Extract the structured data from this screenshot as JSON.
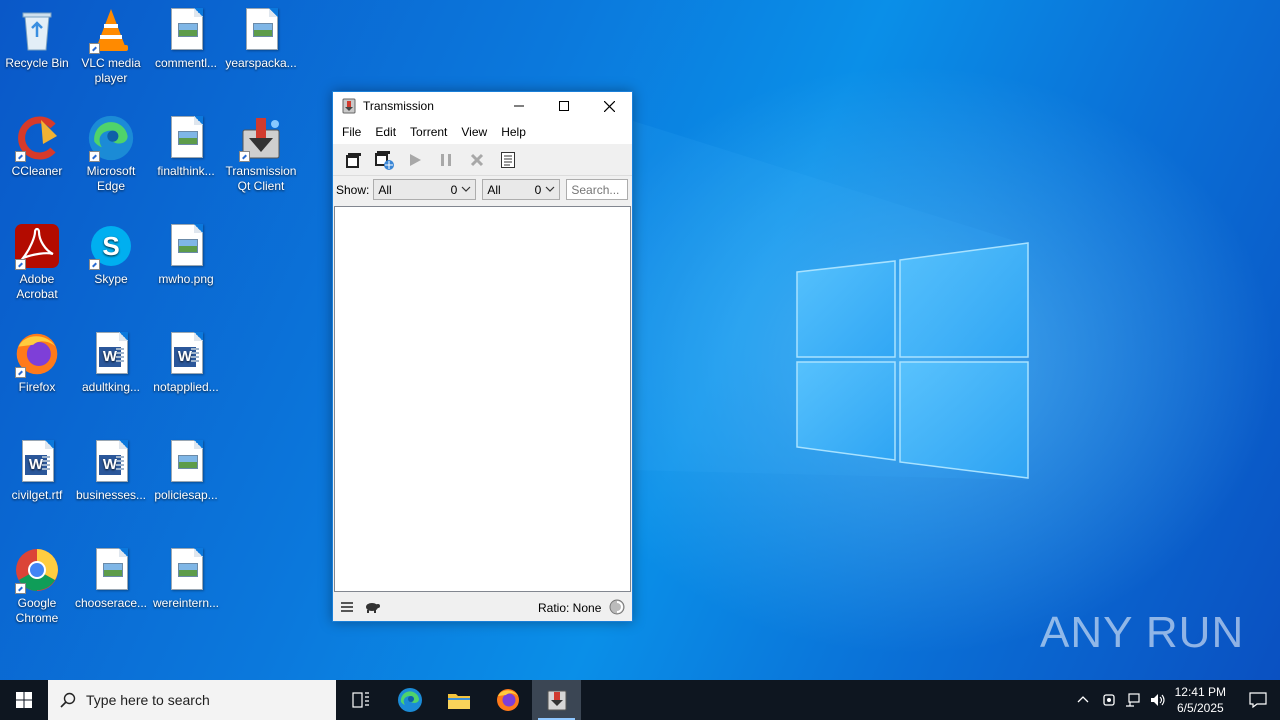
{
  "desktop": {
    "icons": [
      {
        "label": "Recycle Bin",
        "icon": "recycle-bin-icon"
      },
      {
        "label": "VLC media player",
        "icon": "vlc-icon"
      },
      {
        "label": "commentl...",
        "icon": "image-file-icon"
      },
      {
        "label": "yearspacka...",
        "icon": "image-file-icon"
      },
      {
        "label": "CCleaner",
        "icon": "ccleaner-icon"
      },
      {
        "label": "Microsoft Edge",
        "icon": "edge-icon"
      },
      {
        "label": "finalthink...",
        "icon": "image-file-icon"
      },
      {
        "label": "Transmission Qt Client",
        "icon": "transmission-icon"
      },
      {
        "label": "Adobe Acrobat",
        "icon": "acrobat-icon"
      },
      {
        "label": "Skype",
        "icon": "skype-icon"
      },
      {
        "label": "mwho.png",
        "icon": "image-file-icon"
      },
      {
        "label": "Firefox",
        "icon": "firefox-icon"
      },
      {
        "label": "adultking...",
        "icon": "word-file-icon"
      },
      {
        "label": "notapplied...",
        "icon": "word-file-icon"
      },
      {
        "label": "civilget.rtf",
        "icon": "word-file-icon"
      },
      {
        "label": "businesses...",
        "icon": "word-file-icon"
      },
      {
        "label": "policiesap...",
        "icon": "image-file-icon"
      },
      {
        "label": "Google Chrome",
        "icon": "chrome-icon"
      },
      {
        "label": "chooserace...",
        "icon": "image-file-icon"
      },
      {
        "label": "wereintern...",
        "icon": "image-file-icon"
      }
    ]
  },
  "window": {
    "title": "Transmission",
    "menu": [
      "File",
      "Edit",
      "Torrent",
      "View",
      "Help"
    ],
    "filter": {
      "show_label": "Show:",
      "activity_value": "All",
      "activity_count": "0",
      "tracker_value": "All",
      "tracker_count": "0",
      "search_placeholder": "Search..."
    },
    "status": {
      "ratio": "Ratio: None"
    }
  },
  "taskbar": {
    "search_placeholder": "Type here to search",
    "time": "12:41 PM",
    "date": "6/5/2025"
  },
  "watermark": "ANY RUN",
  "colors": {
    "accent": "#0078d7",
    "taskbar": "#0e1620"
  }
}
